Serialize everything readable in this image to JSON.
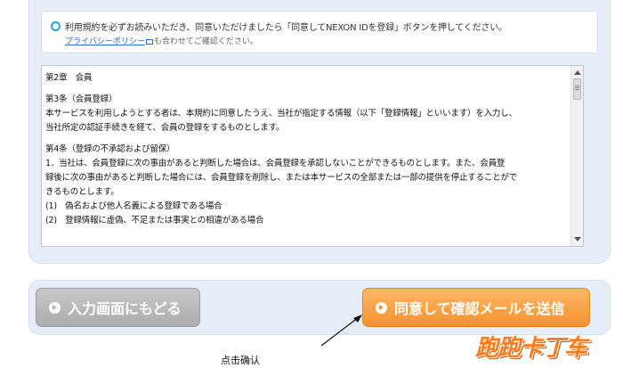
{
  "notice": {
    "text": "利用規約を必ずお読みいただき、同意いただけましたら「同意してNEXON IDを登録」ボタンを押してください。",
    "privacy_link": "プライバシーポリシー",
    "privacy_suffix": "も合わせてご確認ください。"
  },
  "terms": {
    "lines": [
      "第2章　会員",
      "",
      "第3条（会員登録）",
      "本サービスを利用しようとする者は、本規約に同意したうえ、当社が指定する情報（以下「登録情報」といいます）を入力し、",
      "当社所定の認証手続きを経て、会員の登録をするものとします。",
      "",
      "第4条（登録の不承認および留保）",
      "1．当社は、会員登録に次の事由があると判断した場合は、会員登録を承認しないことができるものとします。また、会員登",
      "録後に次の事由があると判断した場合には、会員登録を削除し、または本サービスの全部または一部の提供を停止することがで",
      "きるものとします。",
      "(1)　偽名および他人名義による登録である場合",
      "(2)　登録情報に虚偽、不足または事実との相違がある場合"
    ]
  },
  "buttons": {
    "back_label": "入力画面にもどる",
    "agree_label": "同意して確認メールを送信"
  },
  "annotation": {
    "text": "点击确认"
  },
  "watermark": {
    "text": "跑跑卡丁车"
  },
  "colors": {
    "accent_orange": "#f5922e",
    "panel_bg": "#e6eef9",
    "link_blue": "#2b6bc8",
    "notice_icon": "#2aa3dc"
  }
}
